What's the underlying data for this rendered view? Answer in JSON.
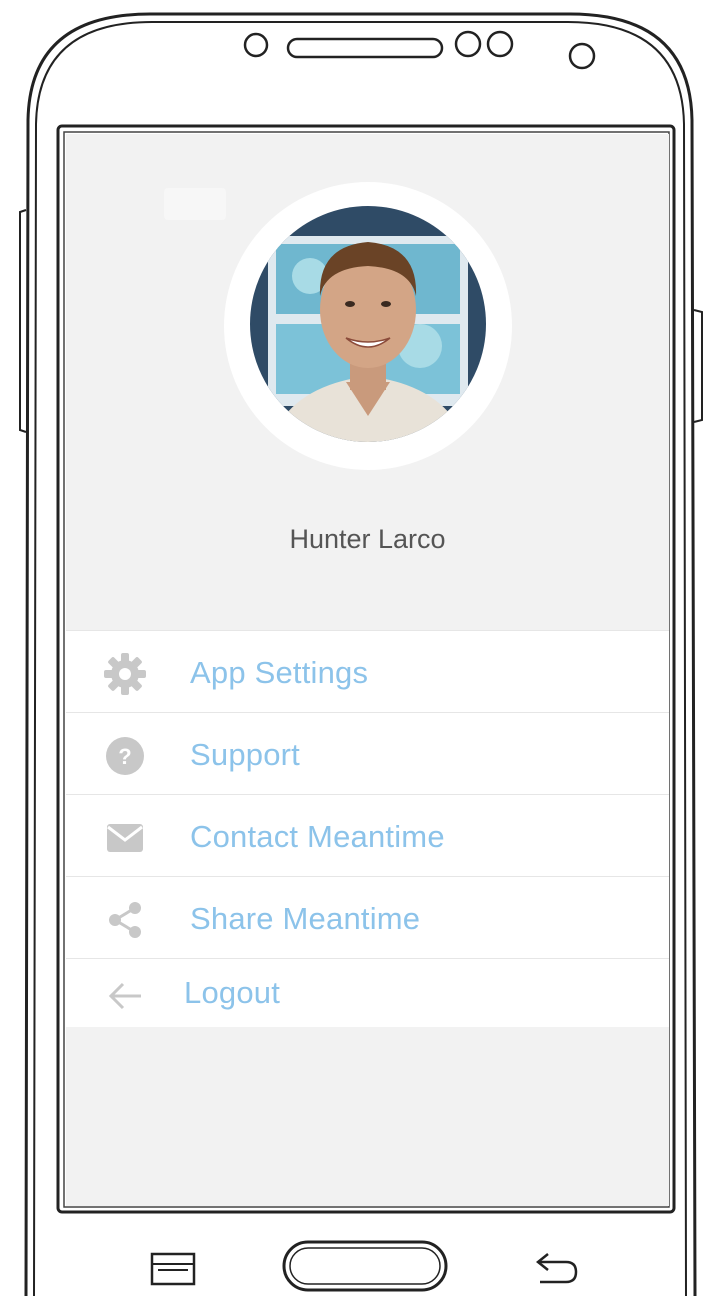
{
  "profile": {
    "name": "Hunter Larco",
    "avatar_icon": "user-photo"
  },
  "menu": {
    "items": [
      {
        "label": "App Settings",
        "icon": "gear-icon"
      },
      {
        "label": "Support",
        "icon": "help-circle-icon"
      },
      {
        "label": "Contact Meantime",
        "icon": "envelope-icon"
      },
      {
        "label": "Share Meantime",
        "icon": "share-icon"
      },
      {
        "label": "Logout",
        "icon": "arrow-left-icon"
      }
    ]
  },
  "colors": {
    "accent": "#8cc3ea",
    "icon_gray": "#c8c8c8",
    "screen_bg": "#f2f2f2",
    "name_text": "#555555"
  }
}
